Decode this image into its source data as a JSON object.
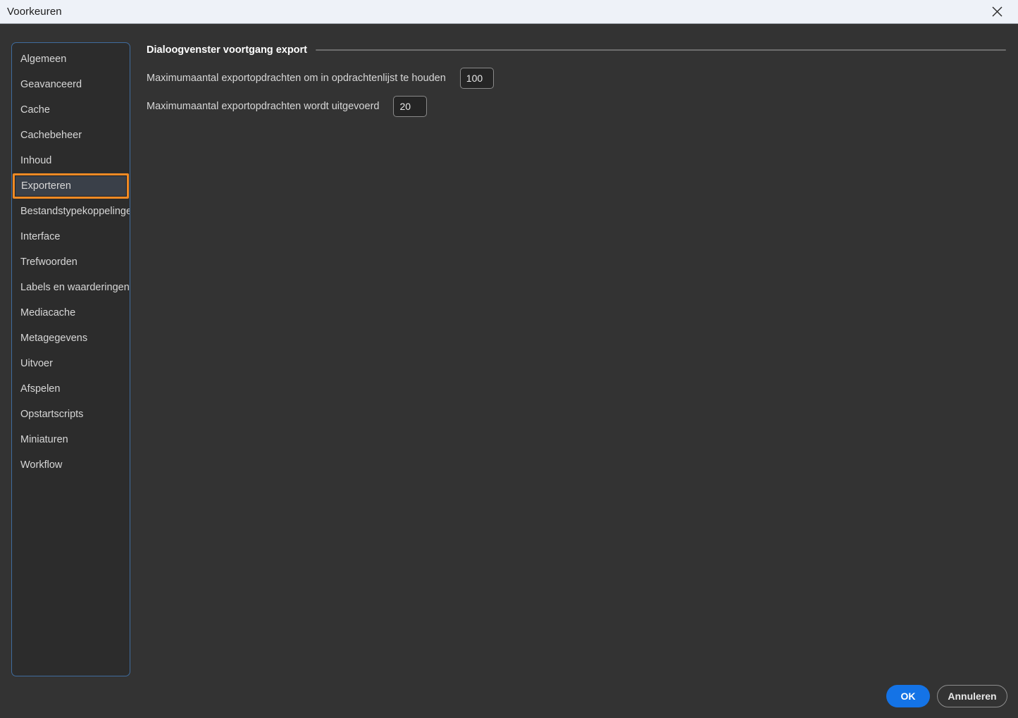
{
  "window": {
    "title": "Voorkeuren",
    "close_icon": "close-x-icon"
  },
  "sidebar": {
    "items": [
      {
        "label": "Algemeen",
        "selected": false
      },
      {
        "label": "Geavanceerd",
        "selected": false
      },
      {
        "label": "Cache",
        "selected": false
      },
      {
        "label": "Cachebeheer",
        "selected": false
      },
      {
        "label": "Inhoud",
        "selected": false
      },
      {
        "label": "Exporteren",
        "selected": true
      },
      {
        "label": "Bestandstypekoppelingen",
        "selected": false
      },
      {
        "label": "Interface",
        "selected": false
      },
      {
        "label": "Trefwoorden",
        "selected": false
      },
      {
        "label": "Labels en waarderingen",
        "selected": false
      },
      {
        "label": "Mediacache",
        "selected": false
      },
      {
        "label": "Metagegevens",
        "selected": false
      },
      {
        "label": "Uitvoer",
        "selected": false
      },
      {
        "label": "Afspelen",
        "selected": false
      },
      {
        "label": "Opstartscripts",
        "selected": false
      },
      {
        "label": "Miniaturen",
        "selected": false
      },
      {
        "label": "Workflow",
        "selected": false
      }
    ]
  },
  "content": {
    "section_title": "Dialoogvenster voortgang export",
    "fields": [
      {
        "label": "Maximumaantal exportopdrachten om in opdrachtenlijst te houden",
        "value": "100"
      },
      {
        "label": "Maximumaantal exportopdrachten wordt uitgevoerd",
        "value": "20"
      }
    ]
  },
  "footer": {
    "ok_label": "OK",
    "cancel_label": "Annuleren"
  },
  "colors": {
    "accent_selected": "#f08a24",
    "panel_border": "#3f6c9e",
    "primary_button": "#1473e6",
    "background": "#333333",
    "sidebar_background": "#2c2c2c",
    "titlebar_background": "#eef2f8"
  }
}
